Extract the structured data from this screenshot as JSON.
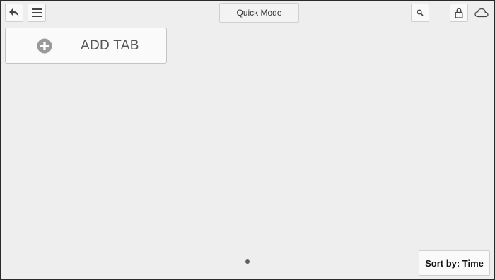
{
  "toolbar": {
    "back_icon": "back-arrow-icon",
    "menu_icon": "hamburger-menu-icon",
    "mode_label": "Quick Mode",
    "search_icon": "search-icon",
    "lock_icon": "lock-icon",
    "cloud_icon": "cloud-icon"
  },
  "tabs": {
    "add_label": "ADD TAB",
    "add_icon": "plus-circle-icon"
  },
  "pager": {
    "pages": 1,
    "current": 1
  },
  "footer": {
    "sort_label": "Sort by: Time"
  },
  "colors": {
    "background": "#eeeeee",
    "icon": "#444444",
    "plus_circle": "#9a9a9a"
  }
}
